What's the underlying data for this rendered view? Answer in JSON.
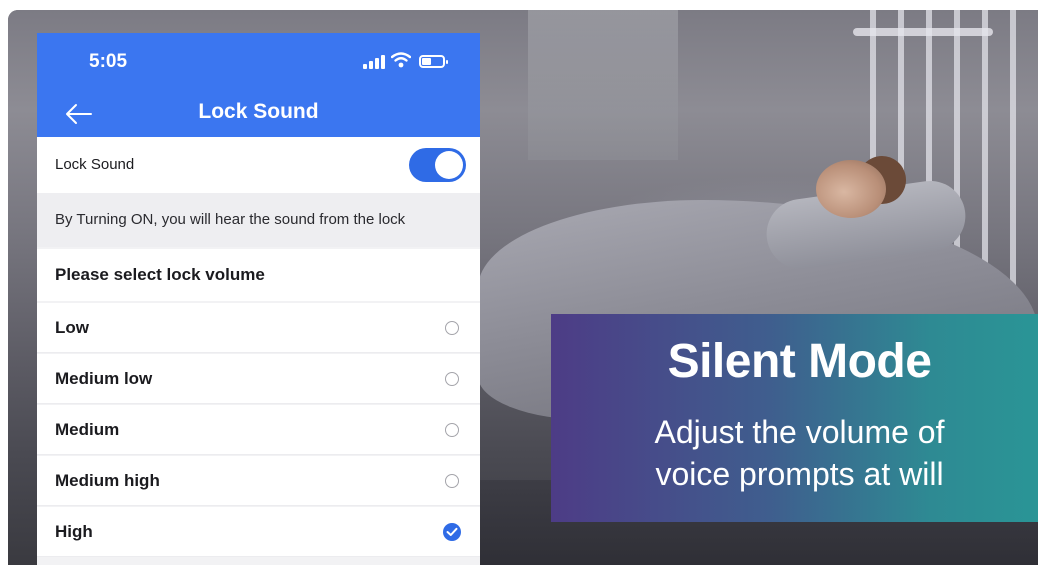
{
  "status_bar": {
    "time": "5:05",
    "icons": [
      "signal-icon",
      "wifi-icon",
      "battery-icon"
    ]
  },
  "nav": {
    "title": "Lock Sound",
    "back_icon": "back-arrow-icon"
  },
  "lock_sound": {
    "label": "Lock Sound",
    "enabled": true
  },
  "info_text": "By Turning ON, you will hear the sound from the lock",
  "volume": {
    "header": "Please select lock volume",
    "options": [
      {
        "label": "Low",
        "selected": false
      },
      {
        "label": "Medium low",
        "selected": false
      },
      {
        "label": "Medium",
        "selected": false
      },
      {
        "label": "Medium high",
        "selected": false
      },
      {
        "label": "High",
        "selected": true
      }
    ]
  },
  "banner": {
    "title": "Silent Mode",
    "line1": "Adjust the volume of",
    "line2": "voice prompts at will"
  },
  "colors": {
    "accent": "#3b76f0",
    "toggle_on": "#2f6be6",
    "banner_start": "#4d3c86",
    "banner_end": "#2a9596"
  }
}
